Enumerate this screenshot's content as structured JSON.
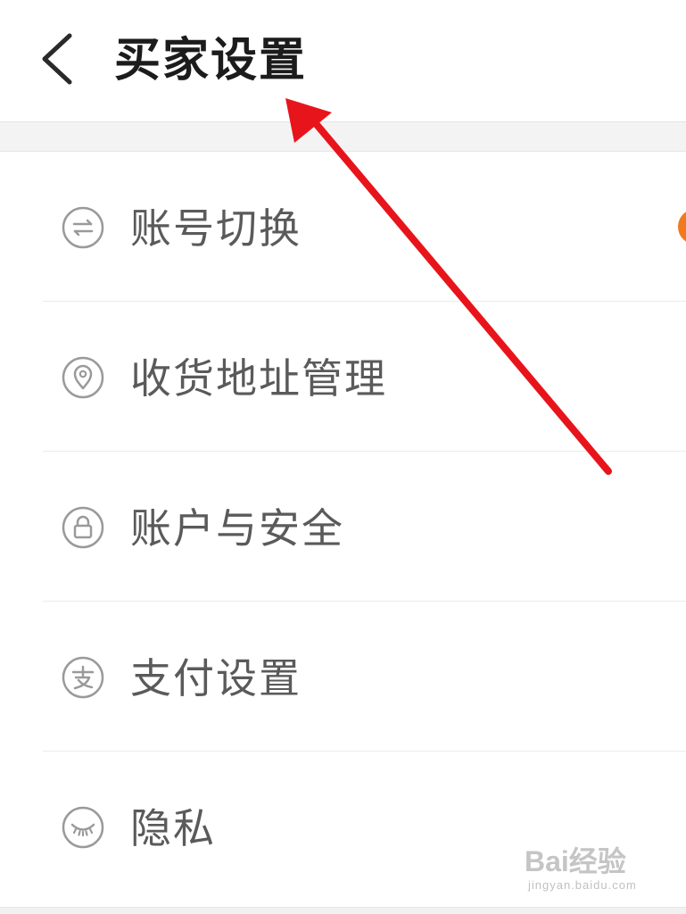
{
  "header": {
    "title": "买家设置",
    "back_icon": "chevron-left-icon"
  },
  "settings": {
    "items": [
      {
        "label": "账号切换",
        "icon": "switch-account-icon",
        "has_badge": true,
        "badge_color": "#f07a1e"
      },
      {
        "label": "收货地址管理",
        "icon": "location-pin-icon"
      },
      {
        "label": "账户与安全",
        "icon": "lock-icon"
      },
      {
        "label": "支付设置",
        "icon": "payment-icon"
      },
      {
        "label": "隐私",
        "icon": "eye-closed-icon"
      }
    ]
  },
  "annotation": {
    "arrow_color": "#e8141b"
  },
  "watermark": {
    "main": "Bai经验",
    "sub": "jingyan.baidu.com"
  },
  "colors": {
    "title": "#1c1c1c",
    "label": "#5a5a5a",
    "icon": "#9a9a9a",
    "badge": "#f07a1e",
    "arrow": "#e8141b"
  }
}
